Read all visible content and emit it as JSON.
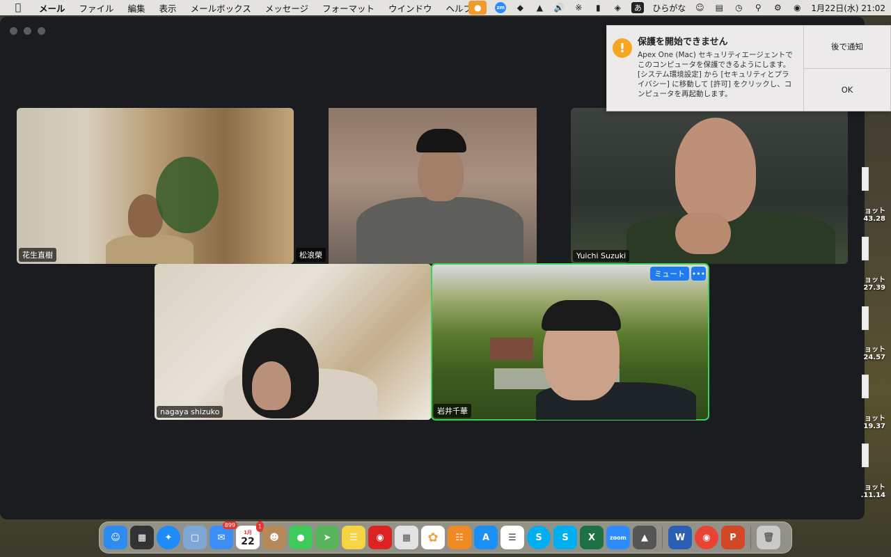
{
  "menubar": {
    "app": "メール",
    "menus": [
      "ファイル",
      "編集",
      "表示",
      "メールボックス",
      "メッセージ",
      "フォーマット",
      "ウインドウ",
      "ヘルプ"
    ],
    "input_method": "ひらがな",
    "kana_label": "あ",
    "zoom_label": "zm",
    "datetime": "1月22日(水) 21:02"
  },
  "participants": [
    {
      "name": "花生直樹"
    },
    {
      "name": "松浪榮"
    },
    {
      "name": "Yuichi Suzuki"
    },
    {
      "name": "nagaya shizuko"
    },
    {
      "name": "岩井千華",
      "active": true
    }
  ],
  "tile_controls": {
    "mute_label": "ミュート",
    "more_label": "•••"
  },
  "notification": {
    "icon_symbol": "!",
    "title": "保護を開始できません",
    "body": "Apex One (Mac) セキュリティエージェントでこのコンピュータを保護できるようにします。[システム環境設定] から [セキュリティとプライバシー] に移動して [許可] をクリックし、コンピュータを再起動します。",
    "later_button": "後で通知",
    "ok_button": "OK"
  },
  "desktop_items": [
    {
      "label": "ョット",
      "sub": "43.28"
    },
    {
      "label": "ョット",
      "sub": "27.39"
    },
    {
      "label": "ョット",
      "sub": "24.57"
    },
    {
      "label": "ョット",
      "sub": "19.37"
    },
    {
      "label": "ョット",
      "sub": ".11.14"
    }
  ],
  "dock": {
    "mail_badge": "899",
    "calendar_month": "1月",
    "calendar_day": "22",
    "calendar_badge": "1",
    "zoom_label": "zoom",
    "colors": {
      "finder": "#2e8cf0",
      "safari": "#1d8cf8",
      "mail": "#3a8ef6",
      "messages": "#3ecb5a",
      "maps": "#58b45a",
      "notes": "#f7d443",
      "photos": "#f2a33c",
      "books": "#f08a24",
      "appstore": "#1a8ff5",
      "skype": "#00aff0",
      "excel": "#1e7144",
      "zoom": "#2d8cff",
      "word": "#2b5fb4",
      "chrome": "#e94335",
      "powerpoint": "#d24726"
    }
  }
}
